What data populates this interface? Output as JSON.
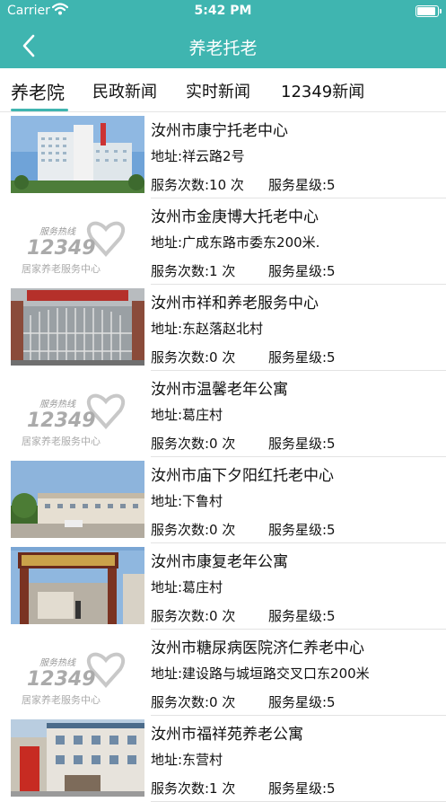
{
  "status_bar": {
    "carrier": "Carrier",
    "time": "5:42 PM"
  },
  "navbar": {
    "title": "养老托老"
  },
  "tabs": [
    {
      "label": "养老院",
      "active": true
    },
    {
      "label": "民政新闻",
      "active": false
    },
    {
      "label": "实时新闻",
      "active": false
    },
    {
      "label": "12349新闻",
      "active": false
    }
  ],
  "placeholder_logo": {
    "line1": "服务热线",
    "number": "12349",
    "line2": "居家养老服务中心"
  },
  "colors": {
    "accent": "#3fb5b0",
    "divider": "#e3e3e3"
  },
  "items": [
    {
      "name": "汝州市康宁托老中心",
      "address": "地址:祥云路2号",
      "count": "服务次数:10 次",
      "stars": "服务星级:5",
      "image": "hospital-building-photo"
    },
    {
      "name": "汝州市金庚博大托老中心",
      "address": "地址:广成东路市委东200米.",
      "count": "服务次数:1 次",
      "stars": "服务星级:5",
      "image": "hotline-12349-logo"
    },
    {
      "name": "汝州市祥和养老服务中心",
      "address": "地址:东赵落赵北村",
      "count": "服务次数:0 次",
      "stars": "服务星级:5",
      "image": "gate-photo"
    },
    {
      "name": "汝州市温馨老年公寓",
      "address": "地址:葛庄村",
      "count": "服务次数:0 次",
      "stars": "服务星级:5",
      "image": "hotline-12349-logo"
    },
    {
      "name": "汝州市庙下夕阳红托老中心",
      "address": "地址:下鲁村",
      "count": "服务次数:0 次",
      "stars": "服务星级:5",
      "image": "courtyard-building-photo"
    },
    {
      "name": "汝州市康复老年公寓",
      "address": "地址:葛庄村",
      "count": "服务次数:0 次",
      "stars": "服务星级:5",
      "image": "archway-gate-photo"
    },
    {
      "name": "汝州市糖尿病医院济仁养老中心",
      "address": "地址:建设路与城垣路交叉口东200米",
      "count": "服务次数:0 次",
      "stars": "服务星级:5",
      "image": "hotline-12349-logo"
    },
    {
      "name": "汝州市福祥苑养老公寓",
      "address": "地址:东营村",
      "count": "服务次数:1 次",
      "stars": "服务星级:5",
      "image": "apartment-building-photo"
    }
  ]
}
